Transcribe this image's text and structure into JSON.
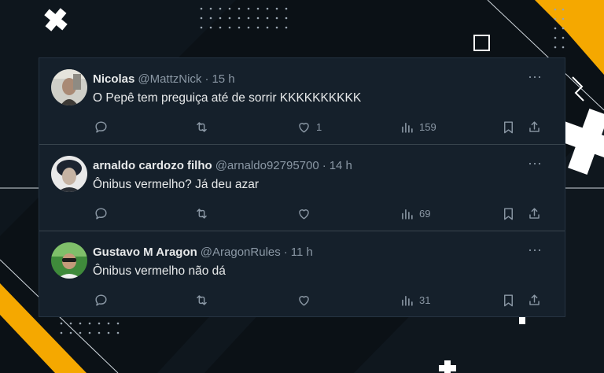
{
  "tweets": [
    {
      "name": "Nicolas",
      "handle": "@MattzNick",
      "separator": "·",
      "time": "15 h",
      "text": "O Pepê tem preguiça até de sorrir KKKKKKKKKK",
      "likes": "1",
      "views": "159"
    },
    {
      "name": "arnaldo cardozo filho",
      "handle": "@arnaldo92795700",
      "separator": "·",
      "time": "14 h",
      "text": "Ônibus vermelho? Já deu azar",
      "likes": "",
      "views": "69"
    },
    {
      "name": "Gustavo M Aragon",
      "handle": "@AragonRules",
      "separator": "·",
      "time": "11 h",
      "text": "Ônibus vermelho não dá",
      "likes": "",
      "views": "31"
    }
  ],
  "more_glyph": "···",
  "colors": {
    "card_bg": "#15202b",
    "accent_yellow": "#f5a800",
    "text_primary": "#e7e9ea",
    "text_secondary": "#8b98a5"
  }
}
